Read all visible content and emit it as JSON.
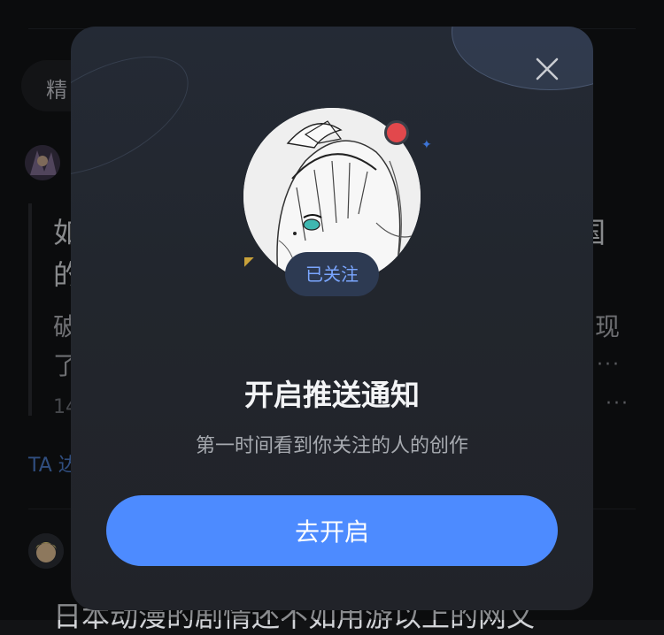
{
  "background": {
    "filter_chip": "精",
    "post1": {
      "title_line1_start": "如",
      "title_line1_end": "国",
      "title_line2_start": "的",
      "body_line1_start": "破",
      "body_line1_end": "现",
      "body_line2_start": "了",
      "meta_start": "14",
      "more": "···"
    },
    "link_text": "TA 达",
    "post2": {
      "title": "日本动漫的剧情还不如用游以上的网文"
    }
  },
  "modal": {
    "followed_badge": "已关注",
    "title": "开启推送通知",
    "subtitle": "第一时间看到你关注的人的创作",
    "cta_label": "去开启"
  },
  "colors": {
    "accent": "#4d8bff",
    "badge_text": "#7aa6ff",
    "red_dot": "#e2484c"
  },
  "icons": {
    "close": "close-icon",
    "avatar": "user-avatar"
  }
}
